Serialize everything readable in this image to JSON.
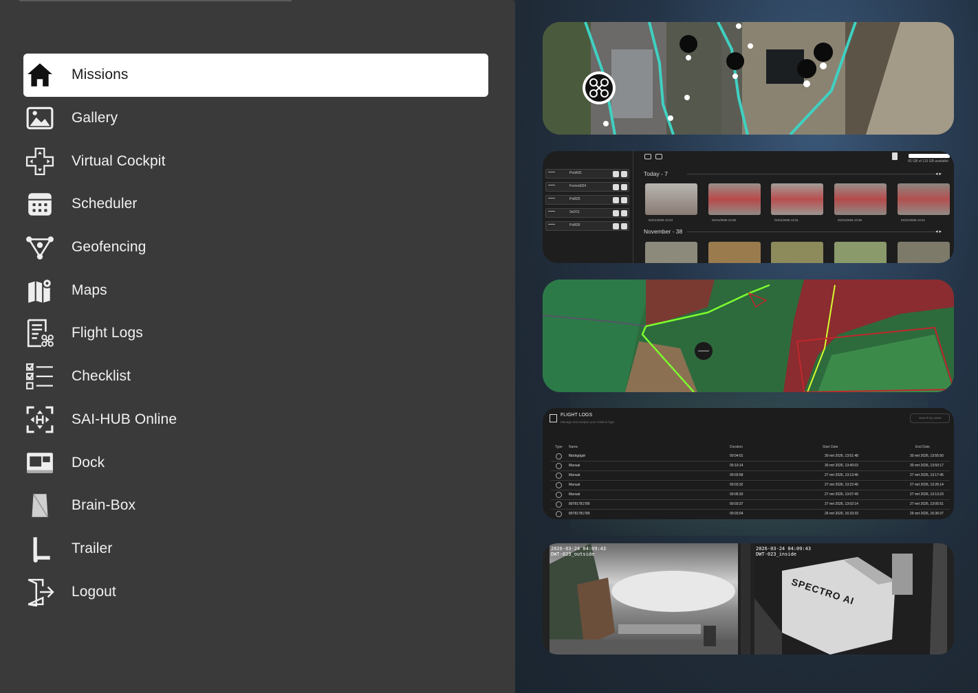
{
  "sidebar": {
    "items": [
      {
        "label": "Missions",
        "icon": "home-icon",
        "active": true
      },
      {
        "label": "Gallery",
        "icon": "gallery-icon",
        "active": false
      },
      {
        "label": "Virtual Cockpit",
        "icon": "dpad-icon",
        "active": false
      },
      {
        "label": "Scheduler",
        "icon": "calendar-icon",
        "active": false
      },
      {
        "label": "Geofencing",
        "icon": "geofence-icon",
        "active": false
      },
      {
        "label": "Maps",
        "icon": "map-icon",
        "active": false
      },
      {
        "label": "Flight Logs",
        "icon": "flight-log-icon",
        "active": false
      },
      {
        "label": "Checklist",
        "icon": "checklist-icon",
        "active": false
      },
      {
        "label": "SAI-HUB Online",
        "icon": "helipad-icon",
        "active": false
      },
      {
        "label": "Dock",
        "icon": "dock-icon",
        "active": false
      },
      {
        "label": "Brain-Box",
        "icon": "brainbox-icon",
        "active": false
      },
      {
        "label": "Trailer",
        "icon": "trailer-icon",
        "active": false
      },
      {
        "label": "Logout",
        "icon": "logout-icon",
        "active": false
      }
    ]
  },
  "gallery_preview": {
    "storage": "65 GB of 115 GB available",
    "drones": [
      "PortA31",
      "Forrest024",
      "Pol825",
      "3oOCt",
      "Pol826"
    ],
    "groups": [
      {
        "header": "Today - 7",
        "captions": [
          "01/01/2026 13:23",
          "01/01/2026 13:25",
          "01/01/2026 13:31",
          "01/01/2026 13:36",
          "01/01/2026 13:41"
        ]
      },
      {
        "header": "November - 38"
      }
    ]
  },
  "flight_logs_preview": {
    "title": "FLIGHT LOGS",
    "subtitle": "Manage and analyse your mission logs",
    "search_placeholder": "Search by name",
    "columns": {
      "type": "Type",
      "name": "Name",
      "duration": "Duration",
      "start": "Start Date",
      "end": "End Date"
    },
    "rows": [
      {
        "name": "fbbdrgdgdr",
        "duration": "00:04:01",
        "start": "30 mrt 2026, 13:51:48",
        "end": "30 mrt 2026, 13:55:50"
      },
      {
        "name": "Manual",
        "duration": "00:10:14",
        "start": "30 mrt 2026, 13:40:03",
        "end": "30 mrt 2026, 13:50:17"
      },
      {
        "name": "Manual",
        "duration": "00:03:58",
        "start": "27 mrt 2026, 13:13:46",
        "end": "27 mrt 2026, 13:17:45"
      },
      {
        "name": "Manual",
        "duration": "00:03:32",
        "start": "27 mrt 2026, 13:22:40",
        "end": "27 mrt 2026, 13:26:14"
      },
      {
        "name": "Manual",
        "duration": "00:05:33",
        "start": "27 mrt 2026, 13:07:49",
        "end": "27 mrt 2026, 13:13:23"
      },
      {
        "name": "89781781789",
        "duration": "00:03:37",
        "start": "27 mrt 2026, 13:02:14",
        "end": "27 mrt 2026, 13:05:51"
      },
      {
        "name": "89781781789",
        "duration": "00:03:04",
        "start": "26 mrt 2026, 16:33:33",
        "end": "26 mrt 2026, 16:36:37"
      }
    ]
  },
  "cameras_preview": {
    "left": {
      "timestamp": "2026-03-24 04:09:43",
      "name": "DWT-023_outside"
    },
    "right": {
      "timestamp": "2026-03-24 04:09:43",
      "name": "DWT-023_inside",
      "logo_text": "SPECTRO AI"
    }
  },
  "colors": {
    "sidebar_bg": "#3a3a3a",
    "active_bg": "#ffffff",
    "route": "#3fd1c2",
    "geofence_allowed": "#7dff2e",
    "geofence_blocked": "#c0282c"
  }
}
